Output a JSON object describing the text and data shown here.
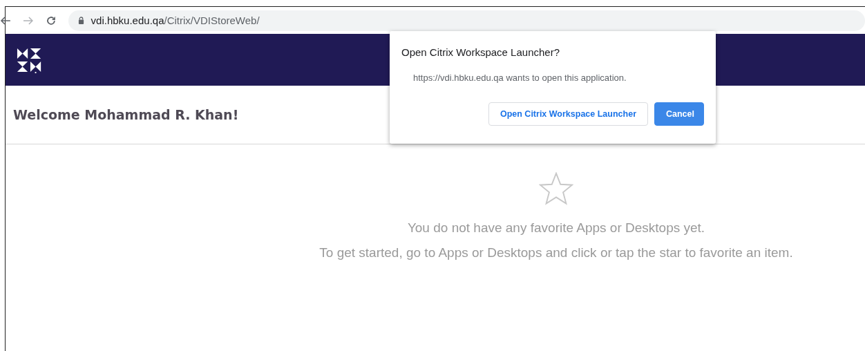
{
  "browser": {
    "url_host": "vdi.hbku.edu.qa",
    "url_path": "/Citrix/VDIStoreWeb/"
  },
  "header": {
    "welcome": "Welcome Mohammad R. Khan!"
  },
  "empty_state": {
    "message": "You do not have any favorite Apps or Desktops yet.",
    "hint": "To get started, go to Apps or Desktops and click or tap the star to favorite an item."
  },
  "dialog": {
    "title": "Open Citrix Workspace Launcher?",
    "message": "https://vdi.hbku.edu.qa wants to open this application.",
    "buttons": [
      {
        "label": "Open Citrix Workspace Launcher",
        "kind": "secondary"
      },
      {
        "label": "Cancel",
        "kind": "primary"
      }
    ]
  }
}
